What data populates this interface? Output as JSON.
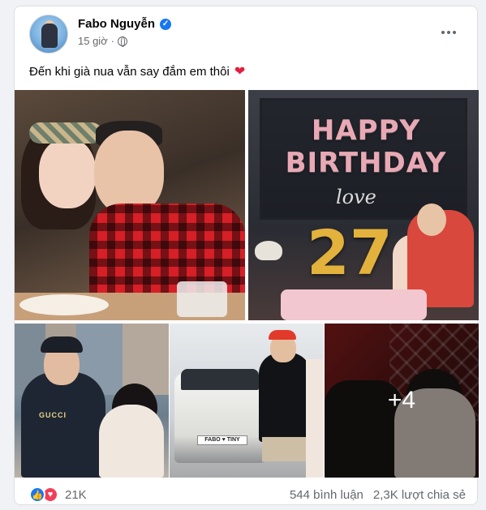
{
  "post": {
    "author": "Fabo Nguyễn",
    "time": "15 giờ",
    "caption": "Đến khi già nua vẫn say đắm em thôi",
    "caption_emoji": "❤️"
  },
  "photos": {
    "p2_text": "HAPPY\nBIRTHDAY",
    "p2_love": "love",
    "p2_number": "27",
    "p3_text": "GUCCI",
    "p4_plate": "FABO ♥ TINY",
    "more_count": "+4"
  },
  "footer": {
    "reactions_count": "21K",
    "comments": "544 bình luận",
    "shares": "2,3K lượt chia sẻ"
  },
  "icons": {
    "verified": "check-badge-icon",
    "privacy": "globe-icon",
    "more": "more-options-icon",
    "like": "like-reaction-icon",
    "love": "love-reaction-icon"
  },
  "colors": {
    "brand": "#1877f2",
    "love": "#f33e58",
    "text_secondary": "#65676b"
  }
}
